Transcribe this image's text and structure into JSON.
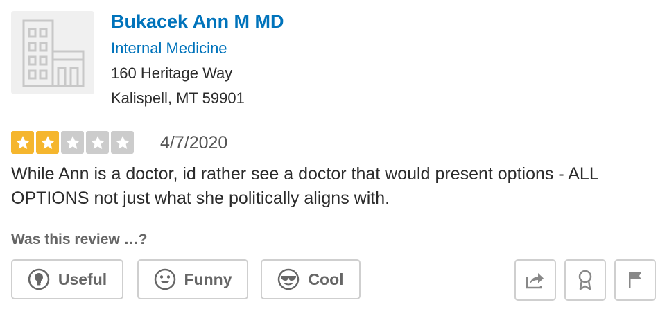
{
  "business": {
    "name": "Bukacek Ann M MD",
    "category": "Internal Medicine",
    "address_line1": "160 Heritage Way",
    "address_line2": "Kalispell, MT 59901",
    "thumbnail_icon": "building-placeholder-icon"
  },
  "review": {
    "rating": 2,
    "max_rating": 5,
    "date": "4/7/2020",
    "text": "While Ann is a doctor, id rather see a doctor that would present options - ALL OPTIONS not just what she politically aligns with."
  },
  "feedback": {
    "question": "Was this review …?",
    "buttons": [
      {
        "label": "Useful",
        "icon": "lightbulb-icon"
      },
      {
        "label": "Funny",
        "icon": "smiley-face-icon"
      },
      {
        "label": "Cool",
        "icon": "sunglasses-face-icon"
      }
    ]
  },
  "actions": [
    {
      "icon": "share-icon"
    },
    {
      "icon": "compliment-award-icon"
    },
    {
      "icon": "flag-icon"
    }
  ],
  "colors": {
    "link": "#0073bb",
    "star_on": "#f5b62e",
    "star_off": "#cccccc",
    "border": "#cfcfcf"
  }
}
